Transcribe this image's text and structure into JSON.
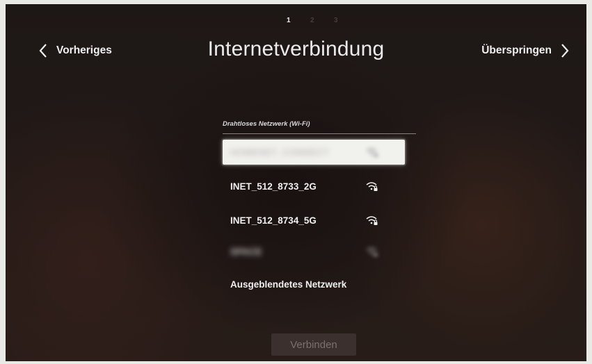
{
  "wizard": {
    "steps": [
      "1",
      "2",
      "3"
    ],
    "active_step": 1
  },
  "header": {
    "title": "Internetverbindung",
    "prev_label": "Vorheriges",
    "next_label": "Überspringen"
  },
  "wifi": {
    "section_label": "Drahtloses Netzwerk (Wi-Fi)",
    "networks": [
      {
        "name": "HOMENET_CONNECT",
        "blurred": true,
        "selected": true,
        "secured": true
      },
      {
        "name": "INET_512_8733_2G",
        "blurred": false,
        "selected": false,
        "secured": true
      },
      {
        "name": "INET_512_8734_5G",
        "blurred": false,
        "selected": false,
        "secured": true
      },
      {
        "name": "SPACE",
        "blurred": true,
        "selected": false,
        "secured": true
      }
    ],
    "hidden_network_label": "Ausgeblendetes Netzwerk"
  },
  "footer": {
    "connect_label": "Verbinden"
  },
  "colors": {
    "background": "#1f1816",
    "text": "#f0f0f0",
    "selected_row": "#f1f1ee",
    "button_disabled_bg": "#3b302d",
    "button_disabled_text": "#7c706c"
  },
  "icons": {
    "prev": "chevron-left-icon",
    "next": "chevron-right-icon",
    "network": "wifi-lock-icon"
  }
}
